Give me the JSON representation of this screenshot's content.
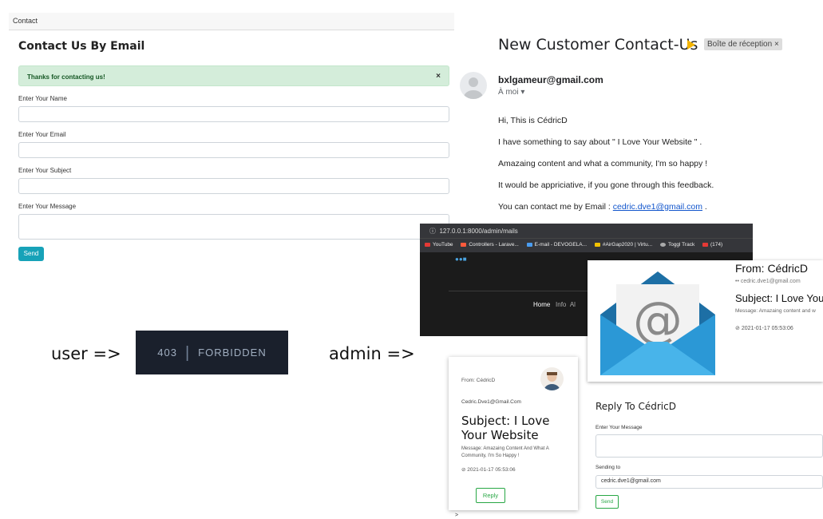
{
  "contact": {
    "tab_title": "Contact",
    "heading": "Contact Us By Email",
    "alert_text": "Thanks for contacting us!",
    "alert_close": "×",
    "name_label": "Enter Your Name",
    "email_label": "Enter Your Email",
    "subject_label": "Enter Your Subject",
    "message_label": "Enter Your Message",
    "send_label": "Send",
    "accent_color": "#17a2b8"
  },
  "access": {
    "user_label": "user =>",
    "admin_label": "admin =>",
    "forbidden_code": "403",
    "forbidden_sep": "|",
    "forbidden_text": "FORBIDDEN"
  },
  "gmail": {
    "subject": "New Customer Contact-Us",
    "label": "Boîte de réception ×",
    "from": "bxlgameur@gmail.com",
    "to": "À moi ▾",
    "line1": "Hi, This is CédricD",
    "line2": "I have something to say about \" I Love Your Website \" .",
    "line3": "Amazaing content and what a community, I'm so happy !",
    "line4": "It would be appriciative, if you gone through this feedback.",
    "line5_prefix": "You can contact me by Email : ",
    "line5_link": "cedric.dve1@gmail.com",
    "line5_suffix": " ."
  },
  "browser": {
    "url": "127.0.0.1:8000/admin/mails",
    "bookmarks": [
      "YouTube",
      "Controllers - Larave...",
      "E-mail - DEVOGELA...",
      "#AirGap2020 | Virtu...",
      "Toggl Track",
      "(174)"
    ],
    "nav_active": "Home",
    "nav_item2": "Info",
    "nav_item3": "Al"
  },
  "card_large": {
    "from": "From: CédricD",
    "email": "cedric.dve1@gmail.com",
    "subject": "Subject: I Love You",
    "message": "Message: Amazaing content and w",
    "date": "2021-01-17 05:53:06"
  },
  "card_small": {
    "from": "From: CédricD",
    "email": "Cedric.Dve1@Gmail.Com",
    "subject": "Subject: I Love Your Website",
    "message": "Message: Amazaing Content And What A Community, I'm So Happy !",
    "date": "2021-01-17 05:53:06",
    "reply_label": "Reply",
    "caret": ">"
  },
  "reply": {
    "title": "Reply To CédricD",
    "message_label": "Enter Your Message",
    "sending_label": "Sending to",
    "sending_value": "cedric.dve1@gmail.com",
    "send_label": "Send"
  }
}
